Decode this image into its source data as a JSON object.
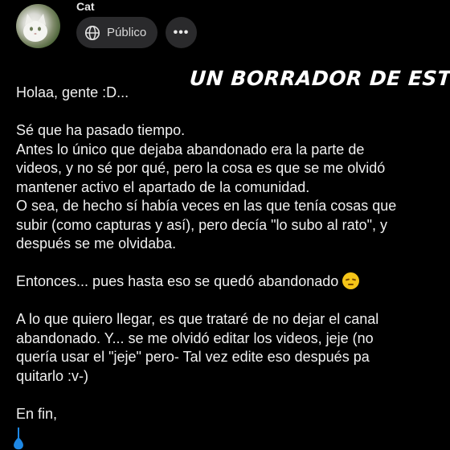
{
  "post": {
    "author": "Cat",
    "privacy_label": "Público",
    "more_label": "•••",
    "overlay_text": "UN BORRADOR DE ESTO",
    "body": {
      "greeting": "Holaa, gente :D...",
      "p2": [
        "Sé que ha pasado tiempo.",
        "Antes lo único que dejaba abandonado era la parte de",
        "videos, y no sé por qué, pero la cosa es que se me olvidó",
        "mantener activo el apartado de la comunidad.",
        "O sea, de hecho sí había veces en las que tenía cosas que",
        "subir (como capturas y así), pero decía \"lo subo al rato\", y",
        "después se me olvidaba."
      ],
      "p3": "Entonces... pues hasta eso se quedó abandonado",
      "p3_emoji": "pensive-face-emoji",
      "p4": [
        "A lo que quiero llegar, es que trataré de no dejar el canal",
        "abandonado. Y... se me olvidó editar los videos, jeje (no",
        "quería usar el \"jeje\" pero- Tal vez edite eso después pa",
        "quitarlo :v-)"
      ],
      "p5": "En fin,"
    }
  },
  "icons": {
    "privacy": "globe-icon",
    "more": "more-options-icon"
  },
  "colors": {
    "background": "#000000",
    "button_bg": "#2a2a2c",
    "text": "#f0f0f0",
    "caret": "#1e88e5"
  }
}
